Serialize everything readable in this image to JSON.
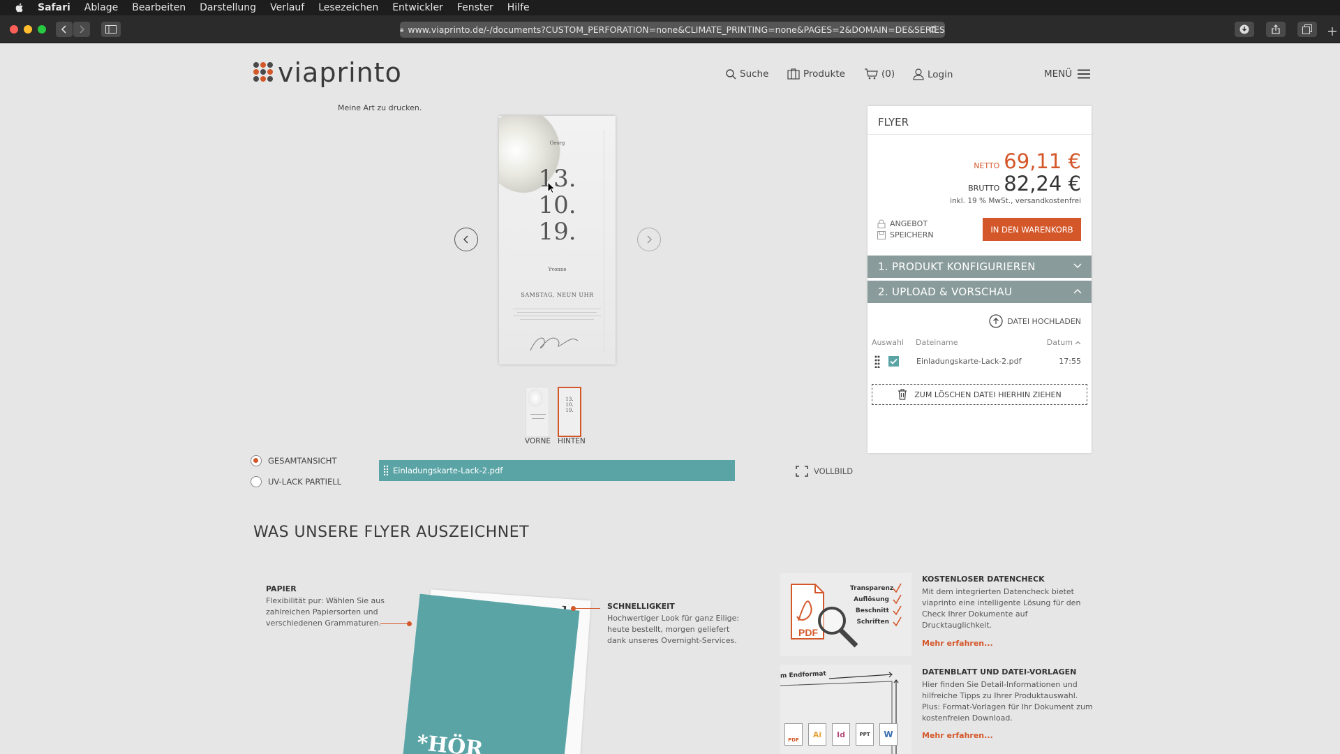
{
  "menubar": {
    "app": "Safari",
    "items": [
      "Ablage",
      "Bearbeiten",
      "Darstellung",
      "Verlauf",
      "Lesezeichen",
      "Entwickler",
      "Fenster",
      "Hilfe"
    ]
  },
  "browser": {
    "url": "www.viaprinto.de/-/documents?CUSTOM_PERFORATION=none&CLIMATE_PRINTING=none&PAGES=2&DOMAIN=DE&SERIES"
  },
  "site": {
    "brand": "viaprinto",
    "tagline": "Meine Art zu drucken.",
    "nav": {
      "search": "Suche",
      "products": "Produkte",
      "cart": "(0)",
      "login": "Login",
      "menu": "MENÜ"
    }
  },
  "preview": {
    "card": {
      "name_top": "Georg",
      "date_1": "13.",
      "date_2": "10.",
      "date_3": "19.",
      "name_bottom": "Yvonne",
      "day": "SAMSTAG, NEUN UHR"
    },
    "thumbs": [
      {
        "label": "VORNE",
        "selected": false
      },
      {
        "label": "HINTEN",
        "selected": true
      }
    ],
    "view_options": [
      {
        "label": "GESAMTANSICHT",
        "selected": true
      },
      {
        "label": "UV-LACK PARTIELL",
        "selected": false
      }
    ],
    "file_bar": "Einladungskarte-Lack-2.pdf",
    "fullscreen": "VOLLBILD"
  },
  "panel": {
    "title": "FLYER",
    "netto_label": "NETTO",
    "netto_value": "69,11 €",
    "brutto_label": "BRUTTO",
    "brutto_value": "82,24 €",
    "tax_note": "inkl. 19 % MwSt., versandkostenfrei",
    "offer": "ANGEBOT",
    "save": "SPEICHERN",
    "cart_button": "IN DEN WARENKORB",
    "step1": "1. PRODUKT KONFIGURIEREN",
    "step2": "2. UPLOAD & VORSCHAU",
    "upload": "DATEI HOCHLADEN",
    "col_select": "Auswahl",
    "col_name": "Dateiname",
    "col_date": "Datum",
    "files": [
      {
        "name": "Einladungskarte-Lack-2.pdf",
        "time": "17:55",
        "checked": true
      }
    ],
    "drop_zone": "ZUM LÖSCHEN DATEI HIERHIN ZIEHEN"
  },
  "features": {
    "heading": "WAS UNSERE FLYER AUSZEICHNET",
    "paper_title": "PAPIER",
    "paper_text": [
      "Flexibilität pur: Wählen Sie aus",
      "zahlreichen Papiersorten und",
      "verschiedenen Grammaturen."
    ],
    "speed_title": "SCHNELLIGKEIT",
    "speed_text": [
      "Hochwertiger Look für ganz Eilige:",
      "heute bestellt, morgen geliefert",
      "dank unseres Overnight-Services."
    ],
    "check_title": "KOSTENLOSER DATENCHECK",
    "check_text": [
      "Mit dem integrierten Datencheck bietet",
      "viaprinto eine intelligente Lösung für den",
      "Check Ihrer Dokumente auf",
      "Drucktauglichkeit."
    ],
    "check_items": [
      "Transparenz",
      "Auflösung",
      "Beschnitt",
      "Schriften"
    ],
    "check_pdf": "PDF",
    "sheet_title": "DATENBLATT UND DATEI-VORLAGEN",
    "sheet_text": [
      "Hier finden Sie Detail-Informationen und",
      "hilfreiche Tipps zu Ihrer Produktauswahl.",
      "Plus: Format-Vorlagen für Ihr Dokument zum",
      "kostenfreien Download."
    ],
    "sheet_caption": "m Endformat",
    "sheet_icons": [
      "PDF",
      "Ai",
      "Id",
      "PPT",
      "W"
    ],
    "more": "Mehr erfahren...",
    "flyer_letter": "b",
    "flyer_cover": "*HÖR"
  },
  "colors": {
    "accent": "#d4572a",
    "teal": "#5ba4a6",
    "accordion": "#8a9b9b"
  }
}
